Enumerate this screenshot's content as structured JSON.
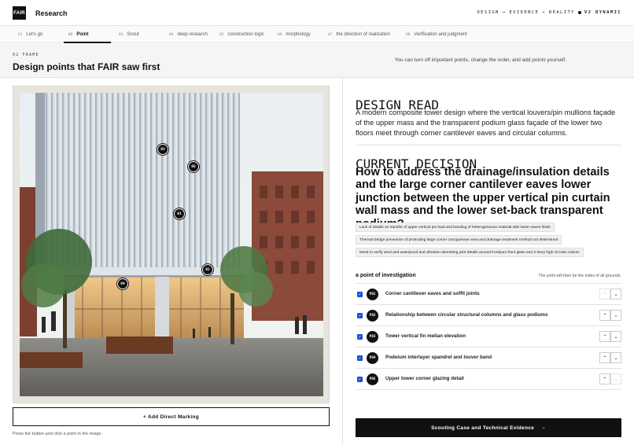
{
  "header": {
    "logo": "FAIR",
    "brand": "Research",
    "tagline": [
      "DESIGN",
      "→",
      "EVIDENCE",
      "→",
      "REALITY",
      "V2 DYNAMIC"
    ]
  },
  "steps": [
    {
      "num": "01",
      "label": "Let's go"
    },
    {
      "num": "02",
      "label": "Point",
      "active": true
    },
    {
      "num": "03",
      "label": "Scout"
    },
    {
      "num": "04",
      "label": "deep research"
    },
    {
      "num": "05",
      "label": "construction logic"
    },
    {
      "num": "06",
      "label": "morphology"
    },
    {
      "num": "07",
      "label": "the direction of realization"
    },
    {
      "num": "08",
      "label": "Verification and judgment"
    }
  ],
  "band": {
    "eyebrow": "02 FRAME",
    "title": "Design points that FAIR saw first",
    "note": "You can turn off important points, change the order, and add points yourself."
  },
  "image": {
    "markers": [
      "01",
      "02",
      "03",
      "04",
      "05"
    ]
  },
  "left": {
    "add_button": "+ Add Direct Marking",
    "hint": "Press the button and click a point in the image."
  },
  "design_read": {
    "label": "DESIGN READ",
    "text": "A modern composite tower design where the vertical louvers/pin mullions façade of the upper mass and the transparent podium glass façade of the lower two floors meet through corner cantilever eaves and circular columns."
  },
  "current_decision": {
    "label": "CURRENT DECISION",
    "question": "How to address the drainage/insulation details and the large corner cantilever eaves lower junction between the upper vertical pin curtain wall mass and the lower set-back transparent podium?",
    "chips": [
      "Lack of details on transfer of upper vertical pin load and bonding of heterogeneous material with lower eaves finish",
      "Thermal bridge prevention of protruding large corner canopy/eave area and drainage treatment method not determined",
      "Need to verify wind and waterproof and vibration absorbing joint details around Fordyum front glass and 2-story high circular column"
    ]
  },
  "investigation": {
    "label": "a point of investigation",
    "note": "The point will then be the index of all grounds.",
    "points": [
      {
        "id": "P01",
        "label": "Corner cantilever eaves and soffit joints"
      },
      {
        "id": "P02",
        "label": "Relationship between circular structural columns and glass podiums"
      },
      {
        "id": "P03",
        "label": "Tower vertical fin melian elevation"
      },
      {
        "id": "P04",
        "label": "Podeium interlayer spandrel and louver band"
      },
      {
        "id": "P05",
        "label": "Upper tower corner glazing detail"
      }
    ]
  },
  "cta": {
    "label": "Scouting Case and Technical Evidence",
    "arrow": "→"
  },
  "colors": {
    "accent": "#111111",
    "checkbox": "#1a4fd6",
    "band_bg": "#f5f5f3"
  },
  "icons": {
    "checkbox": "check-icon",
    "up": "chevron-up-icon",
    "down": "chevron-down-icon",
    "cta": "arrow-right-icon"
  }
}
